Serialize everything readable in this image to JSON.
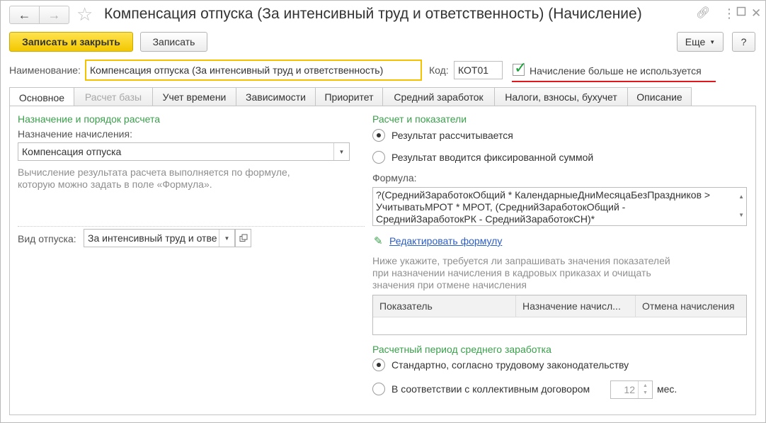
{
  "window": {
    "title": "Компенсация отпуска (За интенсивный труд и ответственность) (Начисление)",
    "icons": [
      "back-arrow-icon",
      "forward-arrow-icon",
      "star-icon",
      "link-icon",
      "more-vertical-icon",
      "maximize-icon",
      "close-icon"
    ]
  },
  "toolbar": {
    "save_close": "Записать и закрыть",
    "save": "Записать",
    "more": "Еще",
    "help": "?"
  },
  "header": {
    "name_label": "Наименование:",
    "name_value": "Компенсация отпуска (За интенсивный труд и ответственность)",
    "code_label": "Код:",
    "code_value": "КОТ01",
    "unused_label": "Начисление больше не используется",
    "unused_checked": true,
    "highlight_color": "#e0181b"
  },
  "tabs": [
    {
      "label": "Основное",
      "state": "active"
    },
    {
      "label": "Расчет базы",
      "state": "disabled"
    },
    {
      "label": "Учет времени",
      "state": "normal"
    },
    {
      "label": "Зависимости",
      "state": "normal"
    },
    {
      "label": "Приоритет",
      "state": "normal"
    },
    {
      "label": "Средний заработок",
      "state": "normal"
    },
    {
      "label": "Налоги, взносы, бухучет",
      "state": "normal"
    },
    {
      "label": "Описание",
      "state": "normal"
    }
  ],
  "left": {
    "section_title": "Назначение и порядок расчета",
    "purpose_label": "Назначение начисления:",
    "purpose_value": "Компенсация отпуска",
    "hint_line1": "Вычисление результата расчета выполняется по формуле,",
    "hint_line2": "которую можно задать в поле «Формула».",
    "leave_label": "Вид отпуска:",
    "leave_value": "За интенсивный труд и отве"
  },
  "right": {
    "section_title": "Расчет и показатели",
    "radio_calc": "Результат рассчитывается",
    "radio_fixed": "Результат вводится фиксированной суммой",
    "formula_label": "Формула:",
    "formula_lines": [
      "?(СреднийЗаработокОбщий * КалендарныеДниМесяцаБезПраздников >",
      "УчитыватьМРОТ * МРОТ, (СреднийЗаработокОбщий -",
      "СреднийЗаработокРК - СреднийЗаработокСН)*"
    ],
    "edit_formula": "Редактировать формулу",
    "note_line1": "Ниже укажите, требуется ли запрашивать значения показателей",
    "note_line2": "при назначении начисления в кадровых приказах и очищать",
    "note_line3": "значения при отмене начисления",
    "grid_headers": [
      "Показатель",
      "Назначение начисл...",
      "Отмена начисления"
    ],
    "period_title": "Расчетный период среднего заработка",
    "radio_standard": "Стандартно, согласно трудовому законодательству",
    "radio_collective": "В соответствии с коллективным договором",
    "months_value": "12",
    "months_unit": "мес."
  },
  "colors": {
    "accent_yellow": "#f3c800",
    "section_green": "#3aa04b",
    "link_blue": "#2a5ec8"
  }
}
